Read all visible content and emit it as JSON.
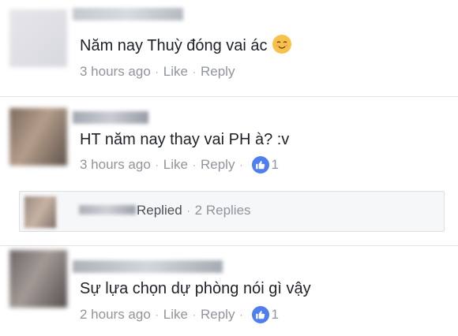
{
  "comments": [
    {
      "text": "Năm nay Thuỳ đóng vai ác",
      "emoji": "relieved-face",
      "time": "3 hours ago",
      "like_label": "Like",
      "reply_label": "Reply"
    },
    {
      "text": "HT năm nay thay vai PH à? :v",
      "time": "3 hours ago",
      "like_label": "Like",
      "reply_label": "Reply",
      "like_count": "1"
    },
    {
      "text": "Sự lựa chọn dự phòng nói gì vậy",
      "time": "2 hours ago",
      "like_label": "Like",
      "reply_label": "Reply",
      "like_count": "1"
    }
  ],
  "reply_thread": {
    "replied_label": "Replied",
    "replies_count_label": "2 Replies"
  },
  "separator": "·",
  "colors": {
    "text": "#1d2129",
    "meta": "#90949c",
    "like_badge": "#4f7ef1",
    "divider": "#e3e4e8"
  }
}
